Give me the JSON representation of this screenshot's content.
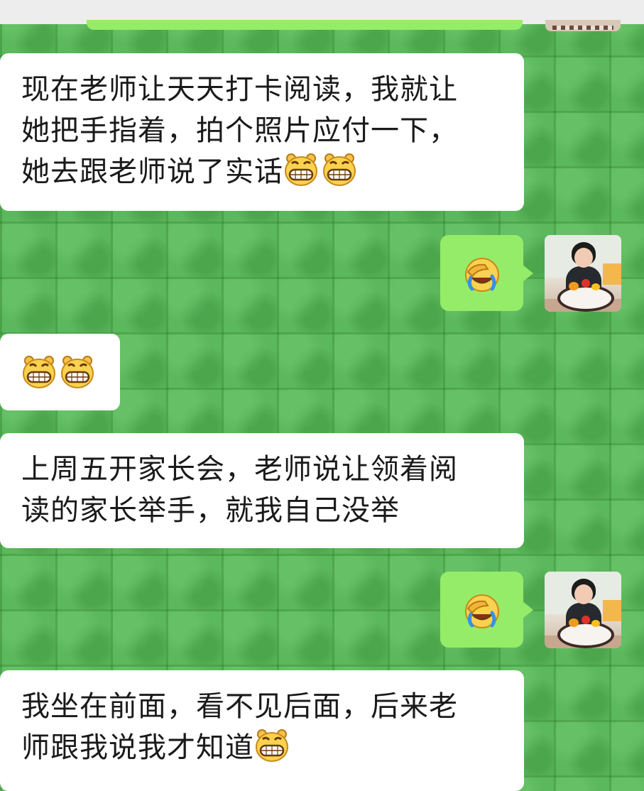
{
  "messages": [
    {
      "side": "left",
      "lines": [
        "现在老师让天天打卡阅读，我就让",
        "她把手指着，拍个照片应付一下，",
        "她去跟老师说了实话"
      ],
      "trailing_emojis": [
        "grin-emoji",
        "grin-emoji"
      ]
    },
    {
      "side": "right",
      "emojis": [
        "facepalm-laugh-emoji"
      ]
    },
    {
      "side": "left",
      "emojis": [
        "grin-emoji",
        "grin-emoji"
      ]
    },
    {
      "side": "left",
      "lines": [
        "上周五开家长会，老师说让领着阅",
        "读的家长举手，就我自己没举"
      ]
    },
    {
      "side": "right",
      "emojis": [
        "facepalm-laugh-emoji"
      ]
    },
    {
      "side": "left",
      "lines": [
        "我坐在前面，看不见后面，后来老",
        "师跟我说我才知道"
      ],
      "trailing_emojis": [
        "grin-emoji"
      ]
    }
  ],
  "colors": {
    "chat_background": "#5cb85c",
    "incoming_bubble": "#ffffff",
    "outgoing_bubble": "#95ec69",
    "text": "#1a1a1a"
  }
}
